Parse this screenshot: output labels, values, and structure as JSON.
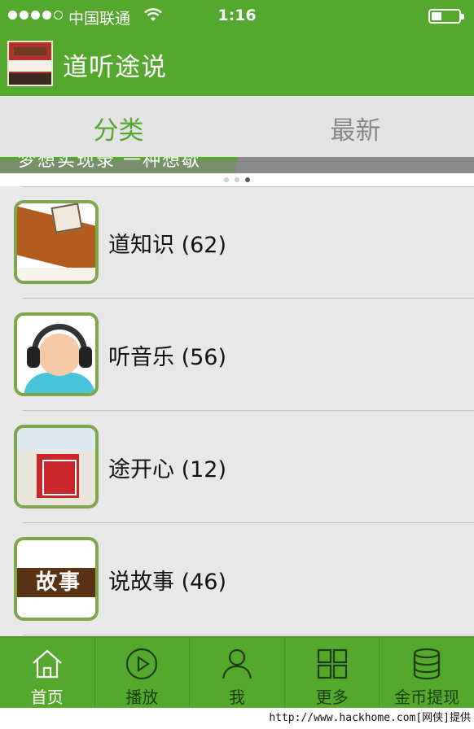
{
  "status_bar": {
    "carrier": "中国联通",
    "time": "1:16",
    "signal_bars_filled": 4,
    "signal_bars_total": 5
  },
  "header": {
    "title": "道听途说"
  },
  "tabs": [
    {
      "label": "分类",
      "active": true
    },
    {
      "label": "最新",
      "active": false
    }
  ],
  "banner": {
    "caption": "梦想实现录 一种想歇",
    "page_count": 3,
    "current_page": 3
  },
  "categories": [
    {
      "label": "道知识 (62)",
      "thumb_icon": "history-scroll-icon"
    },
    {
      "label": "听音乐 (56)",
      "thumb_icon": "baby-headphones-icon"
    },
    {
      "label": "途开心 (12)",
      "thumb_icon": "happy-station-icon"
    },
    {
      "label": "说故事 (46)",
      "thumb_icon": "story-sign-icon",
      "thumb_text": "故事"
    }
  ],
  "bottom_nav": [
    {
      "label": "首页",
      "icon": "home-icon",
      "active": true
    },
    {
      "label": "播放",
      "icon": "play-icon",
      "active": false
    },
    {
      "label": "我",
      "icon": "user-icon",
      "active": false
    },
    {
      "label": "更多",
      "icon": "grid-icon",
      "active": false
    },
    {
      "label": "金币提现",
      "icon": "coins-icon",
      "active": false
    }
  ],
  "watermark": "http://www.hackhome.com[网侠]提供",
  "colors": {
    "brand_green": "#55a82e",
    "thumb_border": "#7fa64b",
    "list_bg": "#e8e8e8"
  }
}
